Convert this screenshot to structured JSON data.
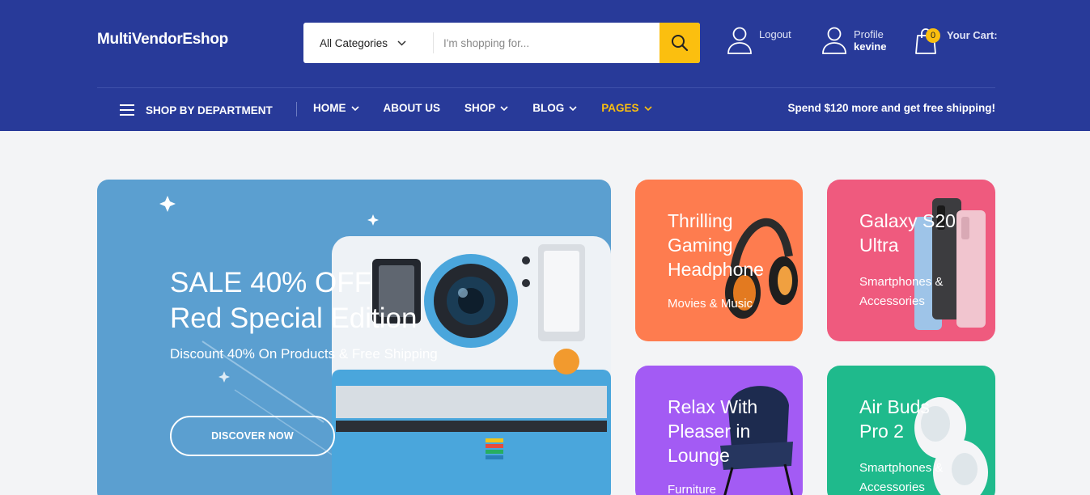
{
  "header": {
    "logo": "MultiVendorEshop",
    "search": {
      "category": "All Categories",
      "placeholder": "I'm shopping for..."
    },
    "logout_label": "Logout",
    "profile": {
      "label": "Profile",
      "username": "kevine"
    },
    "cart": {
      "label": "Your Cart:",
      "count": "0"
    }
  },
  "nav": {
    "department_label": "SHOP BY DEPARTMENT",
    "items": [
      {
        "label": "HOME"
      },
      {
        "label": "ABOUT US"
      },
      {
        "label": "SHOP"
      },
      {
        "label": "BLOG"
      },
      {
        "label": "PAGES"
      }
    ],
    "promo": "Spend $120 more and get free shipping!"
  },
  "hero": {
    "line1": "SALE 40% OFF",
    "line2": "Red Special Edition",
    "subtitle": "Discount 40% On Products & Free Shipping",
    "cta": "DISCOVER NOW"
  },
  "cards": [
    {
      "title": [
        "Thrilling",
        "Gaming",
        "Headphone"
      ],
      "subtitle": [
        "Movies & Music"
      ],
      "color": "#fe7c4f"
    },
    {
      "title": [
        "Galaxy S20",
        "Ultra"
      ],
      "subtitle": [
        "Smartphones &",
        "Accessories"
      ],
      "color": "#ef5a7e"
    },
    {
      "title": [
        "Relax With",
        "Pleaser in",
        "Lounge"
      ],
      "subtitle": [
        "Furniture"
      ],
      "color": "#a35bf4"
    },
    {
      "title": [
        "Air Buds",
        "Pro 2"
      ],
      "subtitle": [
        "Smartphones &",
        "Accessories"
      ],
      "color": "#1fba8c"
    }
  ],
  "colors": {
    "header_bg": "#283a99",
    "accent": "#fbbf0f",
    "hero_bg": "#5b9fd0"
  }
}
